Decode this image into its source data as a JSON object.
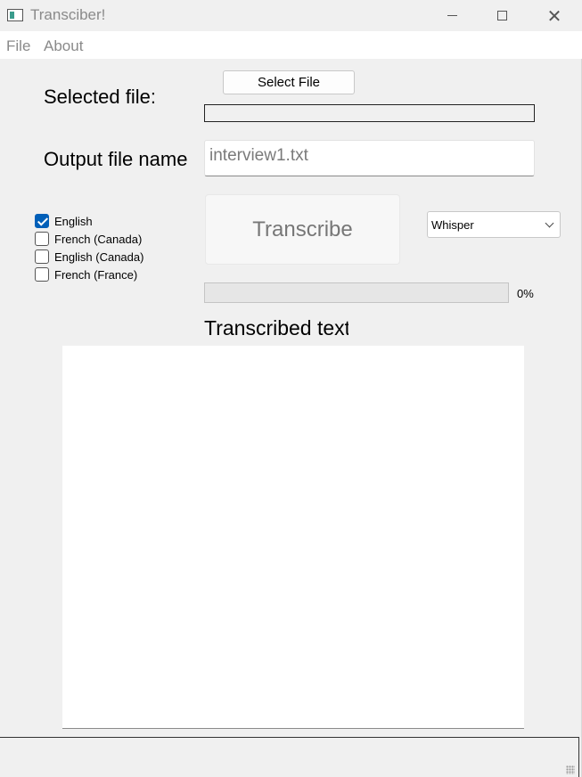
{
  "window": {
    "title": "Transciber!"
  },
  "menu": {
    "file": "File",
    "about": "About"
  },
  "form": {
    "selected_file_label": "Selected file:",
    "select_file_button": "Select File",
    "selected_file_value": "",
    "output_label": "Output file name",
    "output_value": "interview1.txt"
  },
  "languages": [
    {
      "label": "English",
      "checked": true
    },
    {
      "label": "French (Canada)",
      "checked": false
    },
    {
      "label": "English (Canada)",
      "checked": false
    },
    {
      "label": "French (France)",
      "checked": false
    }
  ],
  "actions": {
    "transcribe_button": "Transcribe",
    "model_selected": "Whisper"
  },
  "progress": {
    "value": 0,
    "text": "0%"
  },
  "output": {
    "label": "Transcribed text",
    "content": ""
  },
  "colors": {
    "accent": "#005fb8",
    "background": "#f0f0f0"
  }
}
